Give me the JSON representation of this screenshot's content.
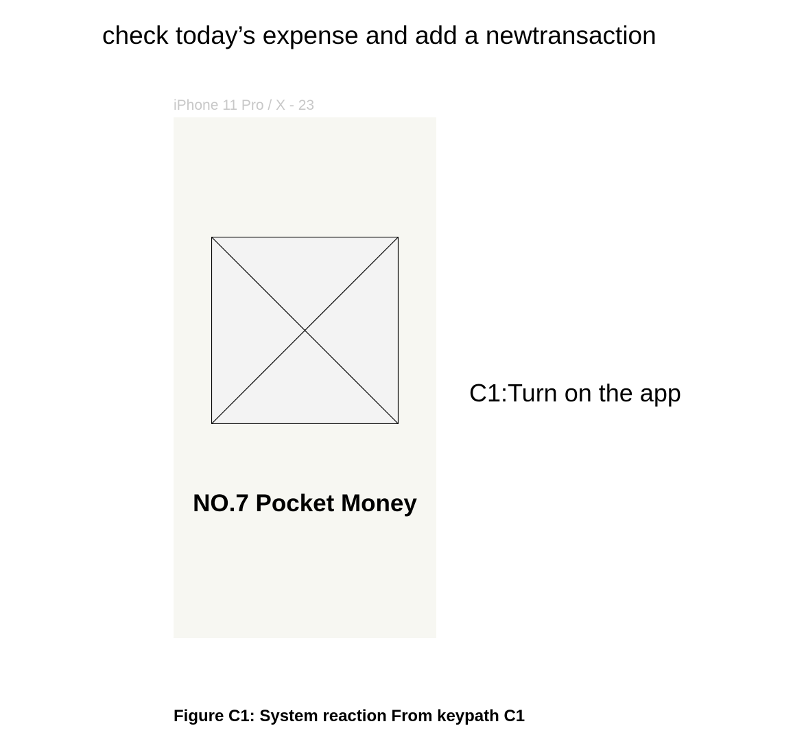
{
  "task": {
    "heading": "check today’s expense and add a newtransaction"
  },
  "frame": {
    "label": "iPhone 11 Pro / X - 23"
  },
  "screen": {
    "image_placeholder": "image-placeholder-icon",
    "app_title": "NO.7 Pocket Money"
  },
  "step": {
    "caption": "C1:Turn on the app"
  },
  "figure": {
    "caption": "Figure C1: System reaction From keypath C1"
  },
  "colors": {
    "frame_background": "#f7f7f2",
    "placeholder_fill": "#f3f3f3",
    "frame_label": "#c8c8c8",
    "text": "#000000"
  }
}
